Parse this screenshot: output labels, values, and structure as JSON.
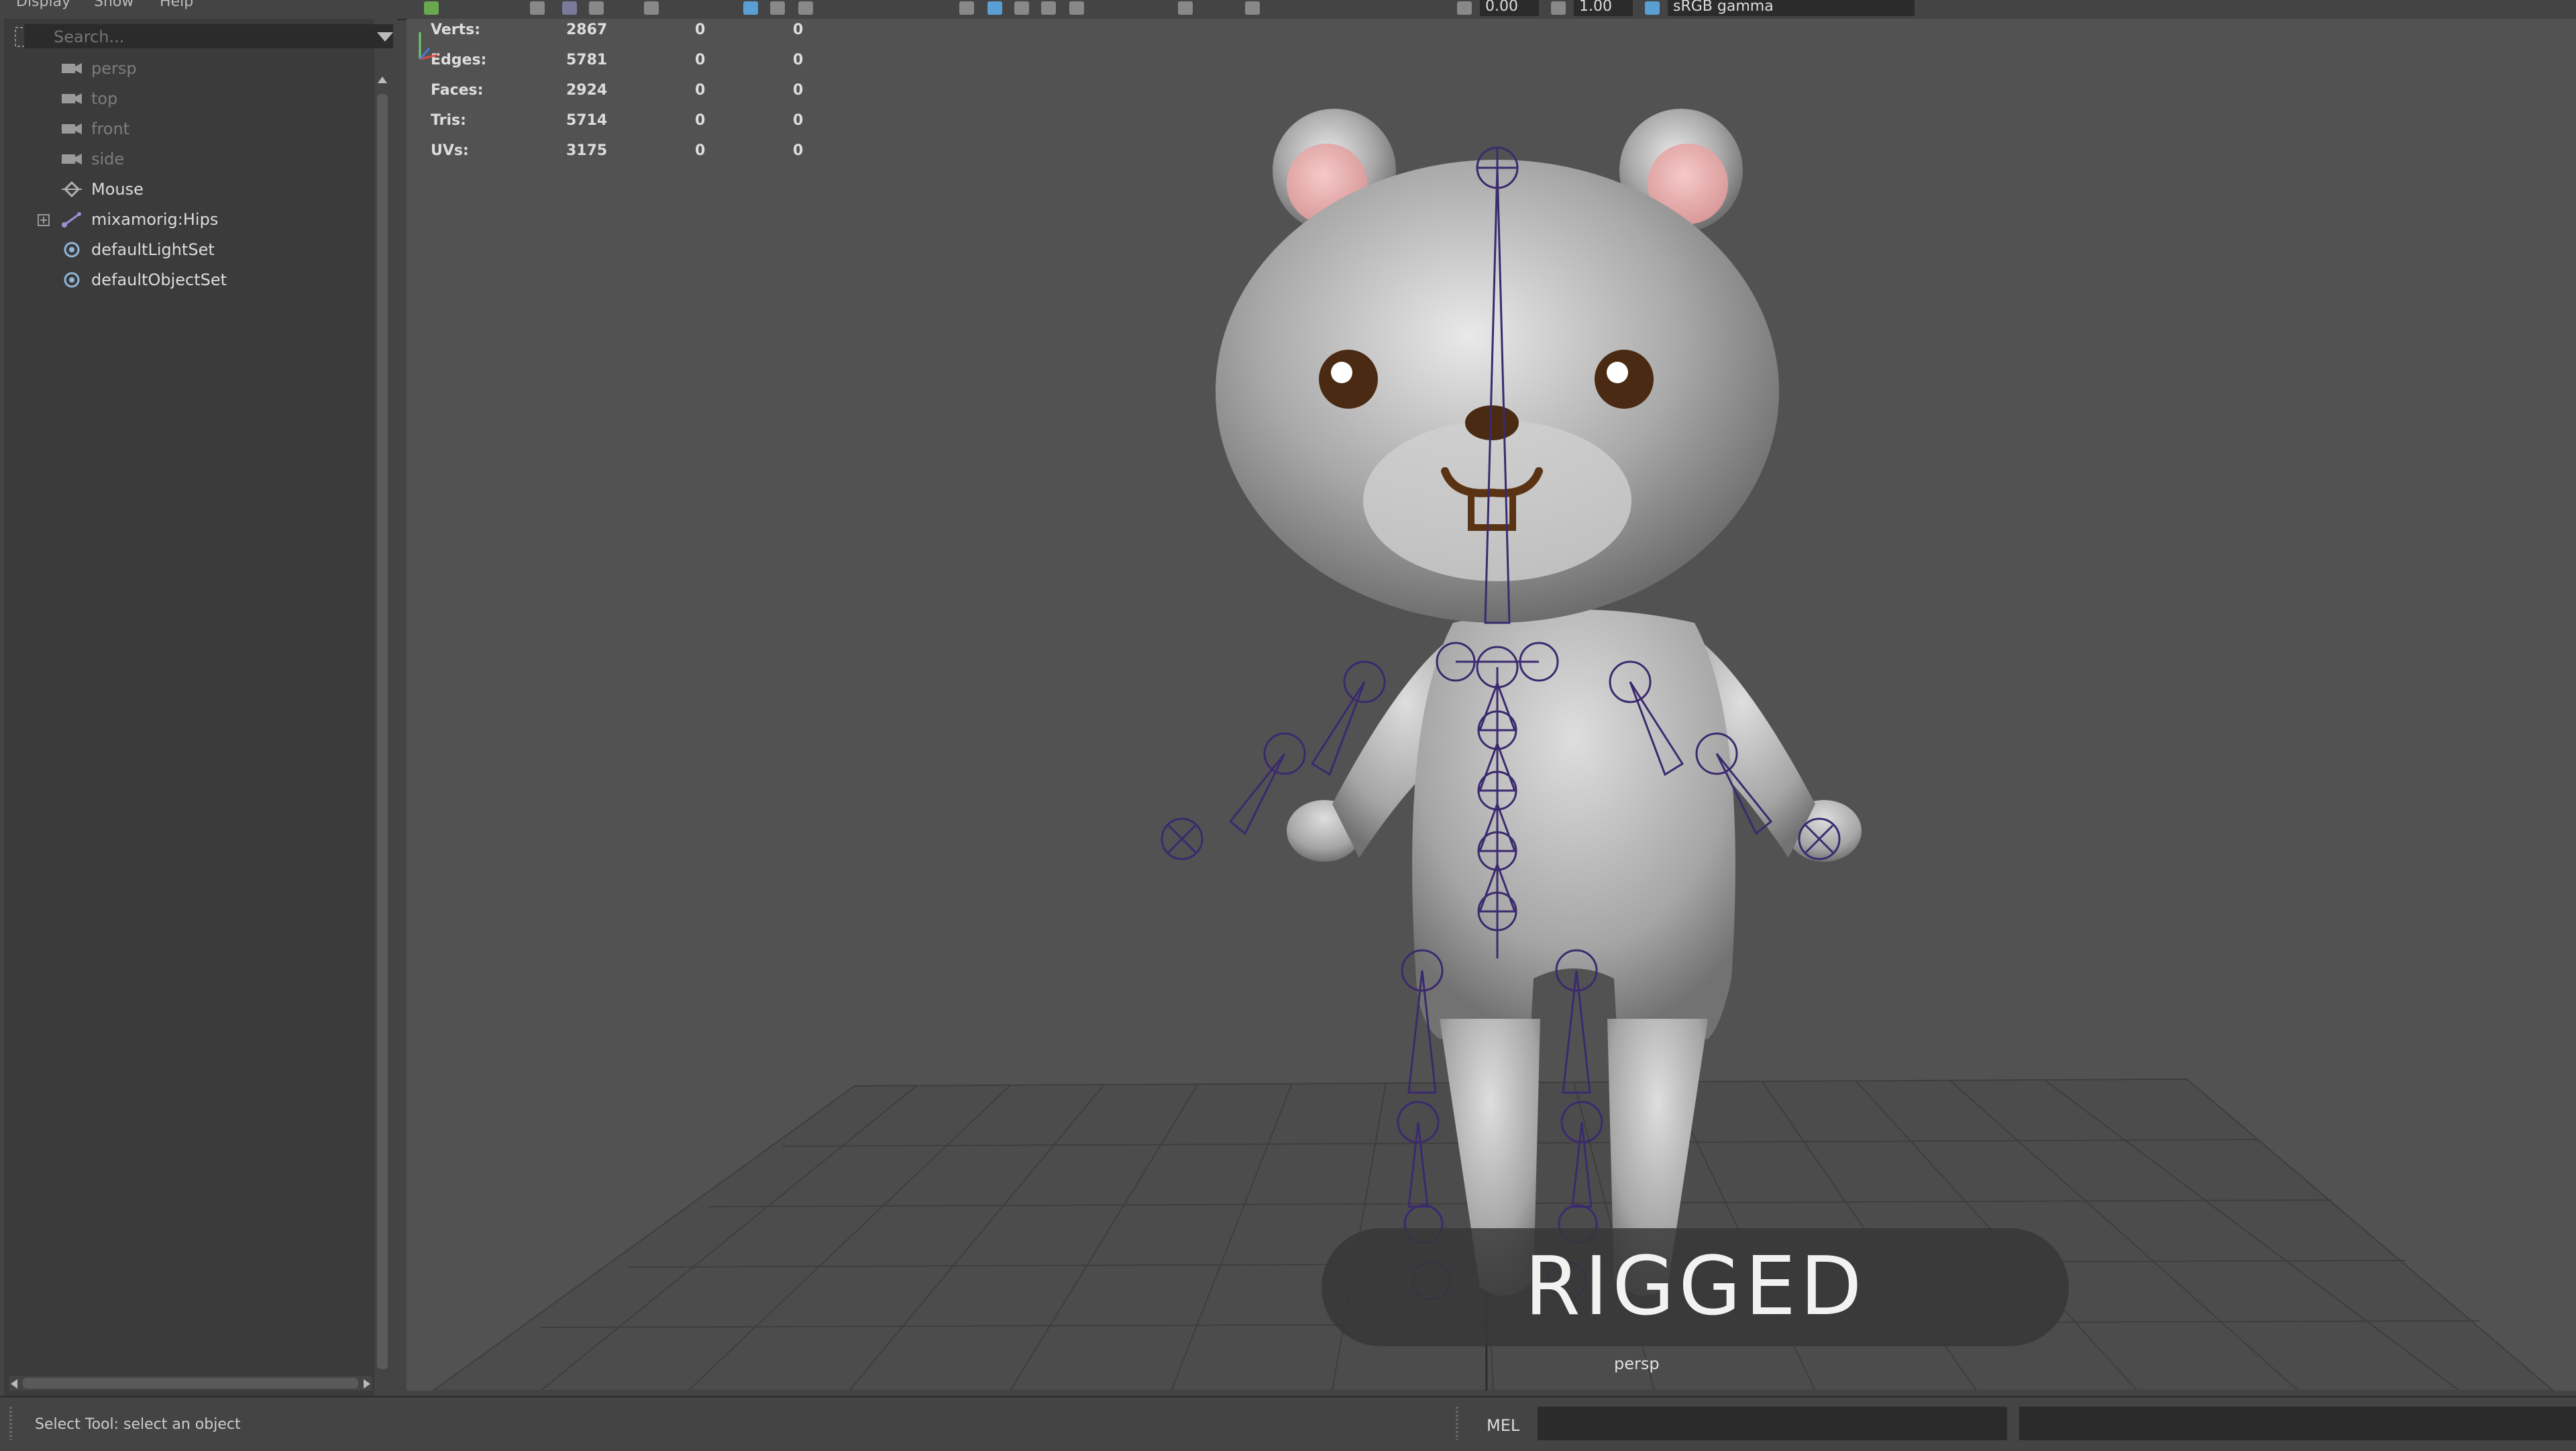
{
  "menubar": {
    "items": [
      "Display",
      "Show",
      "Help"
    ]
  },
  "toolbar": {
    "exposure_value": "0.00",
    "gamma_value": "1.00",
    "color_space": "sRGB gamma"
  },
  "outliner": {
    "search_placeholder": "Search...",
    "items": [
      {
        "label": "persp",
        "icon": "camera-icon",
        "muted": true
      },
      {
        "label": "top",
        "icon": "camera-icon",
        "muted": true
      },
      {
        "label": "front",
        "icon": "camera-icon",
        "muted": true
      },
      {
        "label": "side",
        "icon": "camera-icon",
        "muted": true
      },
      {
        "label": "Mouse",
        "icon": "transform-node-icon",
        "muted": false
      },
      {
        "label": "mixamorig:Hips",
        "icon": "joint-icon",
        "muted": false,
        "expandable": true
      },
      {
        "label": "defaultLightSet",
        "icon": "set-icon",
        "muted": false
      },
      {
        "label": "defaultObjectSet",
        "icon": "set-icon",
        "muted": false
      }
    ]
  },
  "hud": {
    "rows": [
      {
        "label": "Verts:",
        "values": [
          "2867",
          "0",
          "0"
        ]
      },
      {
        "label": "Edges:",
        "values": [
          "5781",
          "0",
          "0"
        ]
      },
      {
        "label": "Faces:",
        "values": [
          "2924",
          "0",
          "0"
        ]
      },
      {
        "label": "Tris:",
        "values": [
          "5714",
          "0",
          "0"
        ]
      },
      {
        "label": "UVs:",
        "values": [
          "3175",
          "0",
          "0"
        ]
      }
    ]
  },
  "viewport": {
    "banner_text": "RIGGED",
    "camera_name": "persp"
  },
  "statusbar": {
    "help_line": "Select Tool: select an object",
    "command_language": "MEL"
  },
  "colors": {
    "ui_bg": "#444444",
    "panel_bg": "#3b3b3b",
    "viewport_bg": "#525252",
    "joint_color": "#3a2a6e",
    "accent_blue": "#5a9fd4"
  }
}
